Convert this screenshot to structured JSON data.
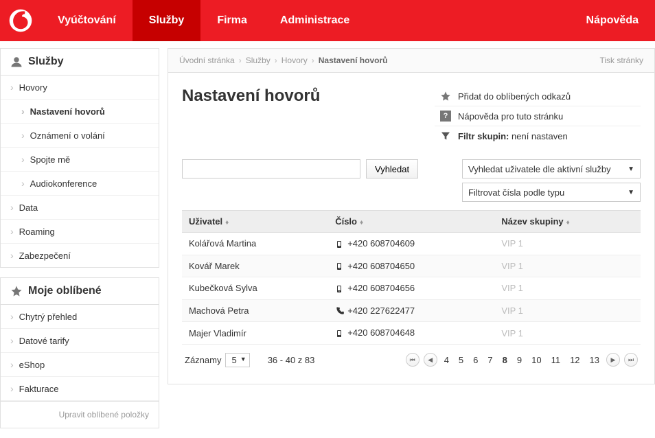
{
  "topnav": {
    "items": [
      "Vyúčtování",
      "Služby",
      "Firma",
      "Administrace"
    ],
    "help": "Nápověda",
    "active_index": 1
  },
  "sidebar": {
    "title": "Služby",
    "items": [
      "Hovory",
      "Data",
      "Roaming",
      "Zabezpečení"
    ],
    "subitems": [
      "Nastavení hovorů",
      "Oznámení o volání",
      "Spojte mě",
      "Audiokonference"
    ],
    "selected_sub_index": 0
  },
  "favorites": {
    "title": "Moje oblíbené",
    "items": [
      "Chytrý přehled",
      "Datové tarify",
      "eShop",
      "Fakturace"
    ],
    "edit": "Upravit oblíbené položky"
  },
  "breadcrumb": {
    "parts": [
      "Úvodní stránka",
      "Služby",
      "Hovory",
      "Nastavení hovorů"
    ],
    "print": "Tisk stránky"
  },
  "page": {
    "title": "Nastavení hovorů",
    "actions": {
      "favorite": "Přidat do oblíbených odkazů",
      "help": "Nápověda pro tuto stránku",
      "filter_label": "Filtr skupin:",
      "filter_value": "není nastaven"
    }
  },
  "search": {
    "button": "Vyhledat",
    "select1": "Vyhledat uživatele dle aktivní služby",
    "select2": "Filtrovat čísla podle typu"
  },
  "table": {
    "headers": [
      "Uživatel",
      "Číslo",
      "Název skupiny"
    ],
    "rows": [
      {
        "user": "Kolářová Martina",
        "number": "+420 608704609",
        "group": "VIP 1",
        "phone_type": "mobile"
      },
      {
        "user": "Kovář Marek",
        "number": "+420 608704650",
        "group": "VIP 1",
        "phone_type": "mobile"
      },
      {
        "user": "Kubečková Sylva",
        "number": "+420 608704656",
        "group": "VIP 1",
        "phone_type": "mobile"
      },
      {
        "user": "Machová Petra",
        "number": "+420 227622477",
        "group": "VIP 1",
        "phone_type": "land"
      },
      {
        "user": "Majer Vladimír",
        "number": "+420 608704648",
        "group": "VIP 1",
        "phone_type": "mobile"
      }
    ]
  },
  "pager": {
    "label": "Záznamy",
    "size": "5",
    "range": "36 - 40 z 83",
    "pages": [
      "4",
      "5",
      "6",
      "7",
      "8",
      "9",
      "10",
      "11",
      "12",
      "13"
    ],
    "current": "8"
  }
}
